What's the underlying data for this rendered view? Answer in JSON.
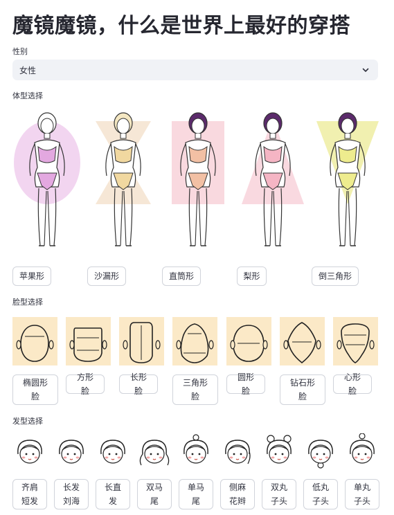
{
  "page": {
    "title": "魔镜魔镜，什么是世界上最好的穿搭"
  },
  "gender": {
    "label": "性别",
    "value": "女性"
  },
  "body_section": {
    "label": "体型选择",
    "options": [
      "苹果形",
      "沙漏形",
      "直筒形",
      "梨形",
      "倒三角形"
    ],
    "backdrop_colors": [
      "#e9b9e6",
      "#f6e7d6",
      "#f7c9d2",
      "#f9d9e0",
      "#f1f0b0"
    ],
    "suit_colors": [
      "#e3a8e0",
      "#f1d8a0",
      "#f2c0a4",
      "#f5b5c4",
      "#eeec8e"
    ]
  },
  "face_section": {
    "label": "脸型选择",
    "options": [
      "椭圆形脸",
      "方形脸",
      "长形脸",
      "三角形脸",
      "圆形脸",
      "钻石形脸",
      "心形脸"
    ],
    "tile_color": "#fbe9c7"
  },
  "hair_section": {
    "label": "发型选择",
    "options": [
      "齐肩短发",
      "长发刘海",
      "长直发",
      "双马尾",
      "单马尾",
      "侧麻花辫",
      "双丸子头",
      "低丸子头",
      "单丸子头"
    ]
  },
  "icons": {
    "dropdown": "chevron-down-icon",
    "body": "body-shape-figure-icon",
    "face": "face-shape-icon",
    "hair": "hairstyle-avatar-icon"
  }
}
